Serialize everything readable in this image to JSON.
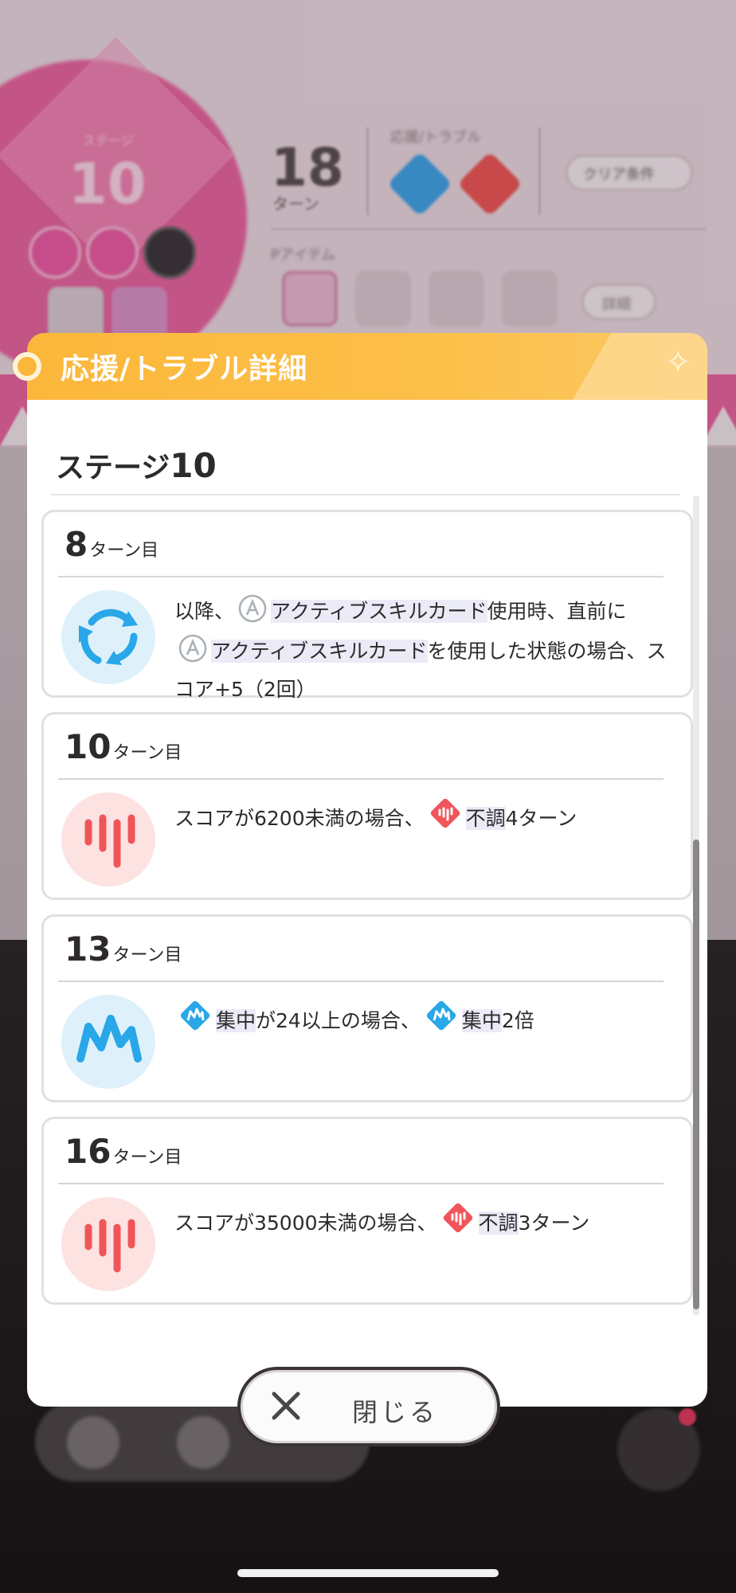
{
  "background": {
    "level_caption": "ステージ",
    "level_number": "10",
    "turns_number": "18",
    "turns_caption": "ターン",
    "support_trouble_caption": "応援/トラブル",
    "clear_condition_label": "クリア条件",
    "items_caption": "Pアイテム",
    "details_label": "詳細"
  },
  "dialog": {
    "title": "応援/トラブル詳細",
    "stage_label": "ステージ",
    "stage_number": "10",
    "events": [
      {
        "turn": "8",
        "turn_suffix": "ターン目",
        "type": "support",
        "icon": "cycle-arrows-icon",
        "parts": {
          "p1": "以降、",
          "h1": "アクティブスキルカード",
          "p2": "使用時、直前に",
          "h2": "アクティブスキルカード",
          "p3": "を使用した状態の場合、スコア+5（2回）"
        }
      },
      {
        "turn": "10",
        "turn_suffix": "ターン目",
        "type": "trouble",
        "icon": "trouble-bars-icon",
        "parts": {
          "p1": "スコアが6200未満の場合、",
          "h1": "不調",
          "p2": "4ターン"
        }
      },
      {
        "turn": "13",
        "turn_suffix": "ターン目",
        "type": "support",
        "icon": "focus-crown-icon",
        "parts": {
          "h1": "集中",
          "p1": "が24以上の場合、",
          "h2": "集中",
          "p2": "2倍"
        }
      },
      {
        "turn": "16",
        "turn_suffix": "ターン目",
        "type": "trouble",
        "icon": "trouble-bars-icon",
        "parts": {
          "p1": "スコアが35000未満の場合、",
          "h1": "不調",
          "p2": "3ターン"
        }
      }
    ],
    "close_label": "閉じる"
  },
  "colors": {
    "header_orange": "#fbb73b",
    "support_blue": "#29a7e8",
    "trouble_red": "#f0555a",
    "highlight_bg": "#ebeaf7"
  }
}
